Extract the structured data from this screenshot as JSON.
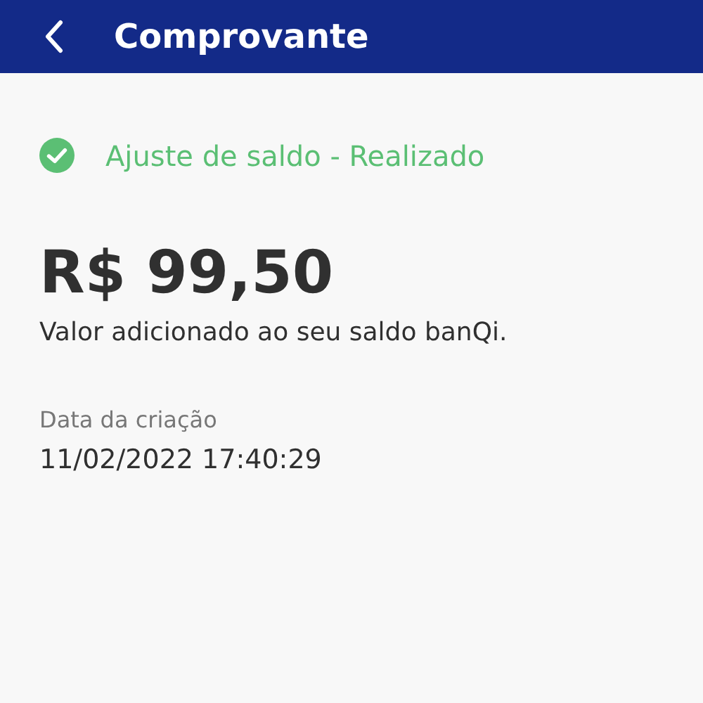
{
  "header": {
    "title": "Comprovante"
  },
  "status": {
    "kind": "success",
    "text": "Ajuste de saldo - Realizado"
  },
  "amount": "R$ 99,50",
  "description": "Valor adicionado ao seu saldo banQi.",
  "created": {
    "label": "Data da criação",
    "value": "11/02/2022 17:40:29"
  }
}
